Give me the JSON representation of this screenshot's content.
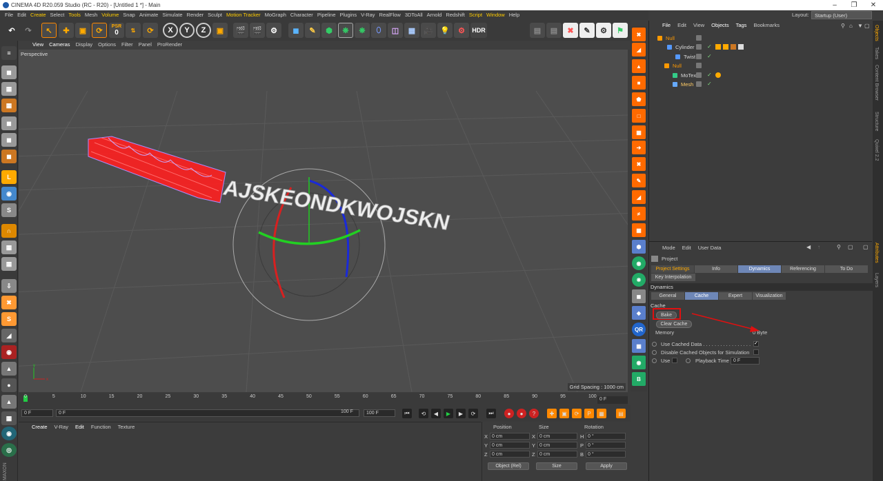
{
  "window": {
    "title": "CINEMA 4D R20.059 Studio (RC - R20) - [Untitled 1 *] - Main",
    "layout_label": "Layout:",
    "layout_value": "Startup (User)"
  },
  "menubar": [
    "File",
    "Edit",
    "Create",
    "Select",
    "Tools",
    "Mesh",
    "Volume",
    "Snap",
    "Animate",
    "Simulate",
    "Render",
    "Sculpt",
    "Motion Tracker",
    "MoGraph",
    "Character",
    "Pipeline",
    "Plugins",
    "V-Ray",
    "RealFlow",
    "3DToAll",
    "Arnold",
    "Redshift",
    "Script",
    "Window",
    "Help"
  ],
  "menubar_highlight": [
    "Create",
    "Tools",
    "Volume",
    "Motion Tracker",
    "Script",
    "Window"
  ],
  "toolbar": {
    "psr_label": "PSR",
    "psr_value": "0",
    "axis_x": "X",
    "axis_y": "Y",
    "axis_z": "Z",
    "hdr": "HDR"
  },
  "viewport": {
    "menu": [
      "View",
      "Cameras",
      "Display",
      "Options",
      "Filter",
      "Panel",
      "ProRender"
    ],
    "label": "Perspective",
    "grid_spacing": "Grid Spacing : 1000 cm",
    "text3d": "AJSKEONDKWOJSKN"
  },
  "timeline": {
    "ticks": [
      "0",
      "5",
      "10",
      "15",
      "20",
      "25",
      "30",
      "35",
      "40",
      "45",
      "50",
      "55",
      "60",
      "65",
      "70",
      "75",
      "80",
      "85",
      "90",
      "95",
      "100"
    ],
    "current_frame": "0 F",
    "end_field": "100 F",
    "start_field": "0 F",
    "range_start": "0 F",
    "range_end": "100 F"
  },
  "material_menu": [
    "Create",
    "V-Ray",
    "Edit",
    "Function",
    "Texture"
  ],
  "coordinates": {
    "headers": [
      "Position",
      "Size",
      "Rotation"
    ],
    "rows": [
      {
        "axis": "X",
        "pos": "0 cm",
        "size_axis": "X",
        "size": "0 cm",
        "rot_axis": "H",
        "rot": "0 °"
      },
      {
        "axis": "Y",
        "pos": "0 cm",
        "size_axis": "Y",
        "size": "0 cm",
        "rot_axis": "P",
        "rot": "0 °"
      },
      {
        "axis": "Z",
        "pos": "0 cm",
        "size_axis": "Z",
        "size": "0 cm",
        "rot_axis": "B",
        "rot": "0 °"
      }
    ],
    "mode": "Object (Rel)",
    "size_mode": "Size",
    "apply": "Apply"
  },
  "object_manager": {
    "menu": [
      "File",
      "Edit",
      "View",
      "Objects",
      "Tags",
      "Bookmarks"
    ],
    "objects": [
      {
        "name": "Null",
        "color": "#ff9900"
      },
      {
        "name": "Cylinder",
        "color": "#d8d8d8"
      },
      {
        "name": "Twist",
        "color": "#d8d8d8"
      },
      {
        "name": "Null",
        "color": "#ff9900"
      },
      {
        "name": "MoText",
        "color": "#d8d8d8"
      },
      {
        "name": "Mesh",
        "color": "#ffcc66"
      }
    ]
  },
  "attributes": {
    "menu": [
      "Mode",
      "Edit",
      "User Data"
    ],
    "title": "Project",
    "tabs1": [
      "Project Settings",
      "Info",
      "Dynamics",
      "Referencing",
      "To Do"
    ],
    "tab_key": "Key Interpolation",
    "section_dynamics": "Dynamics",
    "tabs2": [
      "General",
      "Cache",
      "Expert",
      "Visualization"
    ],
    "section_cache": "Cache",
    "bake": "Bake",
    "clear_cache": "Clear Cache",
    "memory_label": "Memory",
    "memory_value": "0 Byte",
    "use_cached": "Use Cached Data . . . . . . . . . . . . . . . . .",
    "disable_cached": "Disable Cached Objects for Simulation",
    "use": "Use",
    "playback_time": "Playback Time",
    "playback_value": "0 F"
  },
  "side_tabs": [
    "Objects",
    "Takes",
    "Content Browser",
    "Structure",
    "Quixel 2.2"
  ],
  "side_tabs2": [
    "Attributes",
    "Layers"
  ]
}
